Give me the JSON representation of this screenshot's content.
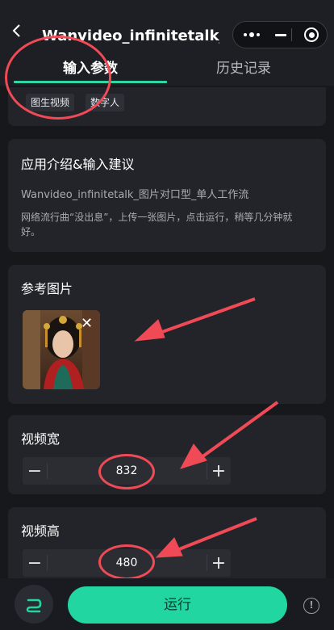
{
  "header": {
    "title": "Wanvideo_infinitetalk_图...",
    "capsule": {
      "more_icon": "more-dots-icon",
      "minimize_icon": "minimize-icon",
      "close_icon": "target-close-icon"
    }
  },
  "tabs": [
    {
      "label": "输入参数",
      "active": true
    },
    {
      "label": "历史记录",
      "active": false
    }
  ],
  "tags": [
    "图生视频",
    "数字人"
  ],
  "intro": {
    "title": "应用介绍&输入建议",
    "description": "Wanvideo_infinitetalk_图片对口型_单人工作流",
    "tip": "网络流行曲“没出息”，上传一张图片，点击运行，稍等几分钟就好。"
  },
  "reference": {
    "title": "参考图片",
    "remove_label": "✕"
  },
  "video_width": {
    "label": "视频宽",
    "value": "832"
  },
  "video_height": {
    "label": "视频高",
    "value": "480"
  },
  "stepper_glyphs": {
    "minus": "−",
    "plus": "+"
  },
  "footer": {
    "run_label": "运行",
    "info_label": "!"
  },
  "colors": {
    "accent": "#21d6a0",
    "annotation": "#ef4a56",
    "background": "#17181c",
    "card": "#22242a"
  }
}
